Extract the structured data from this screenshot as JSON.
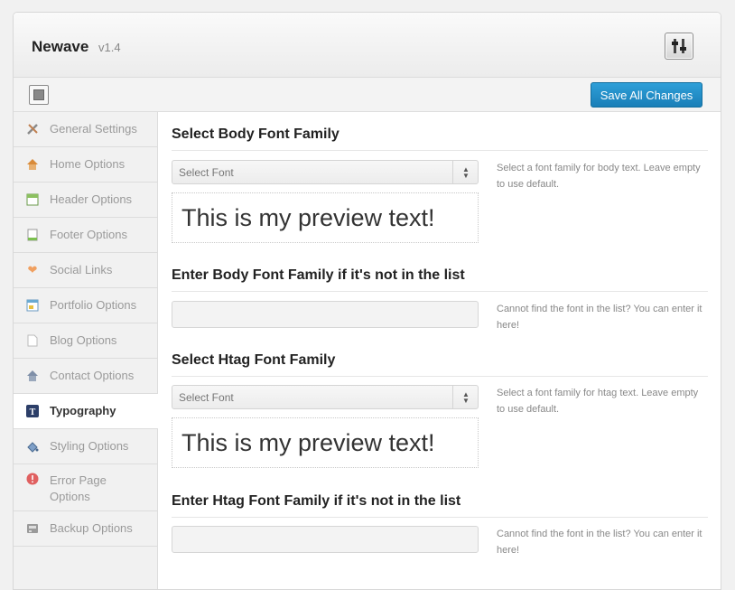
{
  "header": {
    "title": "Newave",
    "version": "v1.4",
    "icon": "sliders-icon"
  },
  "toolbar": {
    "save_label": "Save All Changes",
    "accent": "#1e88c7"
  },
  "sidebar": {
    "items": [
      {
        "label": "General Settings",
        "icon": "tools-icon",
        "color": "#7a7a7a"
      },
      {
        "label": "Home Options",
        "icon": "home-icon",
        "color": "#d98b3a"
      },
      {
        "label": "Header Options",
        "icon": "header-layout-icon",
        "color": "#5aa03a"
      },
      {
        "label": "Footer Options",
        "icon": "document-icon",
        "color": "#6bb24d"
      },
      {
        "label": "Social Links",
        "icon": "heart-icon",
        "color": "#f0a060"
      },
      {
        "label": "Portfolio Options",
        "icon": "portfolio-icon",
        "color": "#4a9ac2"
      },
      {
        "label": "Blog Options",
        "icon": "page-icon",
        "color": "#bbbbbb"
      },
      {
        "label": "Contact Options",
        "icon": "house-icon",
        "color": "#7f8fa8"
      },
      {
        "label": "Typography",
        "icon": "typography-icon",
        "color": "#2c3e68",
        "active": true
      },
      {
        "label": "Styling Options",
        "icon": "paint-bucket-icon",
        "color": "#5a7fa8"
      },
      {
        "label": "Error Page Options",
        "icon": "error-icon",
        "color": "#e06060"
      },
      {
        "label": "Backup Options",
        "icon": "backup-icon",
        "color": "#888888"
      }
    ]
  },
  "main": {
    "body_font": {
      "title": "Select Body Font Family",
      "select_value": "Select Font",
      "preview": "This is my preview text!",
      "description": "Select a font family for body text. Leave empty to use default."
    },
    "body_custom": {
      "title": "Enter Body Font Family if it's not in the list",
      "value": "",
      "description": "Cannot find the font in the list? You can enter it here!"
    },
    "htag_font": {
      "title": "Select Htag Font Family",
      "select_value": "Select Font",
      "preview": "This is my preview text!",
      "description": "Select a font family for htag text. Leave empty to use default."
    },
    "htag_custom": {
      "title": "Enter Htag Font Family if it's not in the list",
      "value": "",
      "description": "Cannot find the font in the list? You can enter it here!"
    }
  }
}
